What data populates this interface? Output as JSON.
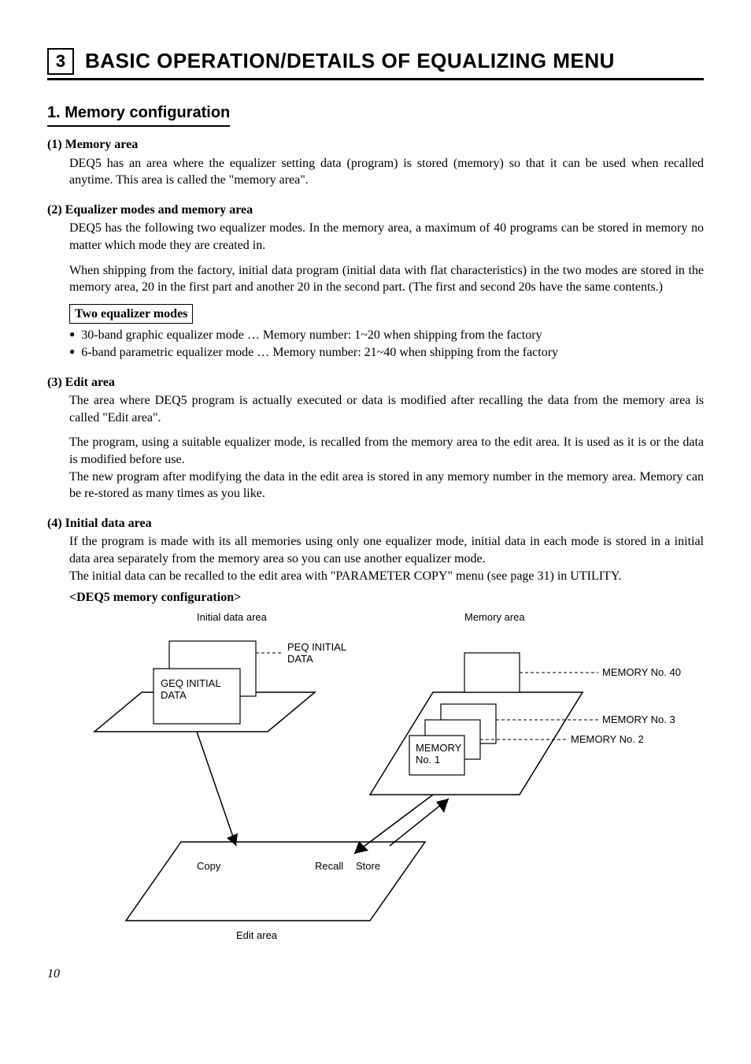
{
  "chapter": {
    "number": "3",
    "title": "BASIC OPERATION/DETAILS OF EQUALIZING MENU"
  },
  "section": {
    "title": "1.  Memory configuration"
  },
  "subs": {
    "s1": {
      "heading": "(1) Memory area",
      "p1": "DEQ5 has an area where the equalizer setting data (program) is stored (memory) so that it can be used when recalled anytime. This area is called the \"memory area\"."
    },
    "s2": {
      "heading": "(2) Equalizer modes and memory area",
      "p1": "DEQ5 has the following two equalizer modes. In the memory area, a maximum of 40 programs can be stored in memory no matter which mode they are created in.",
      "p2": "When shipping from the factory, initial data program (initial data with flat characteristics) in the two modes are stored in the memory area, 20 in the first part and another 20 in the second part. (The first and second 20s have the same contents.)",
      "box": "Two equalizer modes",
      "b1": "30-band graphic equalizer mode … Memory number:    1~20 when shipping from the factory",
      "b2": "6-band parametric equalizer mode … Memory number:  21~40 when shipping from the factory"
    },
    "s3": {
      "heading": "(3) Edit area",
      "p1": "The area where DEQ5 program is actually executed or data is modified after recalling the data from the memory area is called \"Edit area\".",
      "p2": "The program, using a suitable equalizer mode, is recalled from the memory area to the edit area. It is used as it is or the data is modified before use.",
      "p3": "The new program after modifying the data in the edit area is stored in any memory number in the memory area. Memory can be re-stored as many times as you like."
    },
    "s4": {
      "heading": "(4) Initial data area",
      "p1": "If the program is made with its all memories using only one equalizer mode, initial data in each mode is stored in a initial data area separately from the memory area so you can use another equalizer mode.",
      "p2": "The initial data can be recalled to the edit area with \"PARAMETER COPY\" menu (see page 31) in UTILITY.",
      "config_title": "<DEQ5 memory configuration>"
    }
  },
  "diagram": {
    "initial_area": "Initial data area",
    "memory_area": "Memory area",
    "peq": "PEQ INITIAL DATA",
    "geq": "GEQ INITIAL DATA",
    "mem1": "MEMORY No. 1",
    "mem2": "MEMORY No. 2",
    "mem3": "MEMORY No. 3",
    "mem40": "MEMORY No. 40",
    "copy": "Copy",
    "recall": "Recall",
    "store": "Store",
    "edit": "Edit area"
  },
  "page_number": "10"
}
